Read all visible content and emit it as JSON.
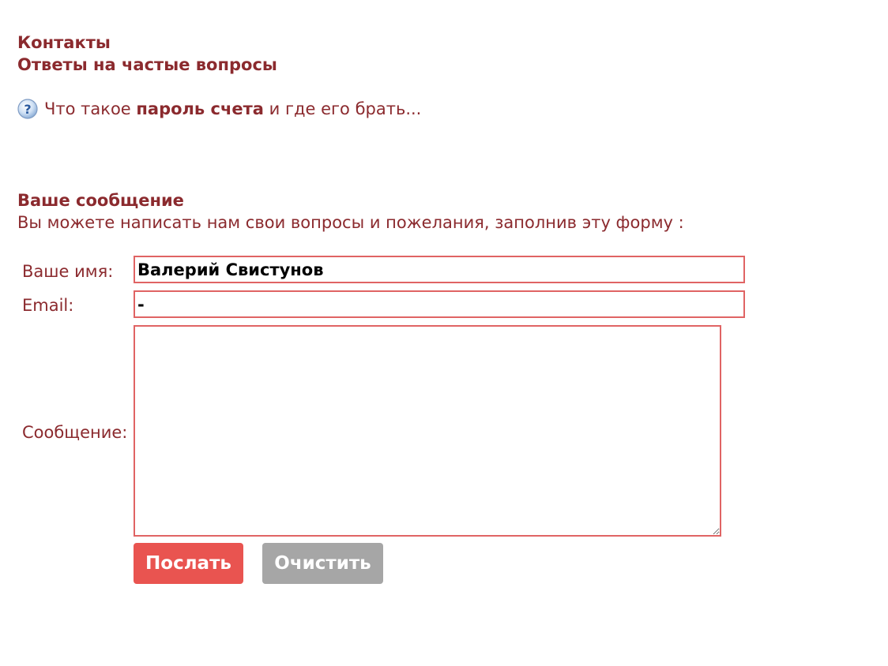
{
  "nav": {
    "contacts": "Контакты",
    "faq": "Ответы на частые вопросы"
  },
  "faq_link": {
    "icon": "help-question-icon",
    "prefix": "Что такое ",
    "bold": "пароль счета",
    "suffix": " и где его брать..."
  },
  "form": {
    "title": "Ваше сообщение",
    "description": "Вы можете написать нам свои вопросы и пожелания, заполнив эту форму :",
    "name_label": "Ваше имя:",
    "name_value": "Валерий Свистунов",
    "email_label": "Email:",
    "email_value": "-",
    "message_label": "Сообщение:",
    "message_value": "",
    "send_label": "Послать",
    "clear_label": "Очистить"
  },
  "colors": {
    "text": "#8b2a2e",
    "field_border": "#e06464",
    "send_button": "#e95450",
    "clear_button": "#a6a6a6"
  }
}
